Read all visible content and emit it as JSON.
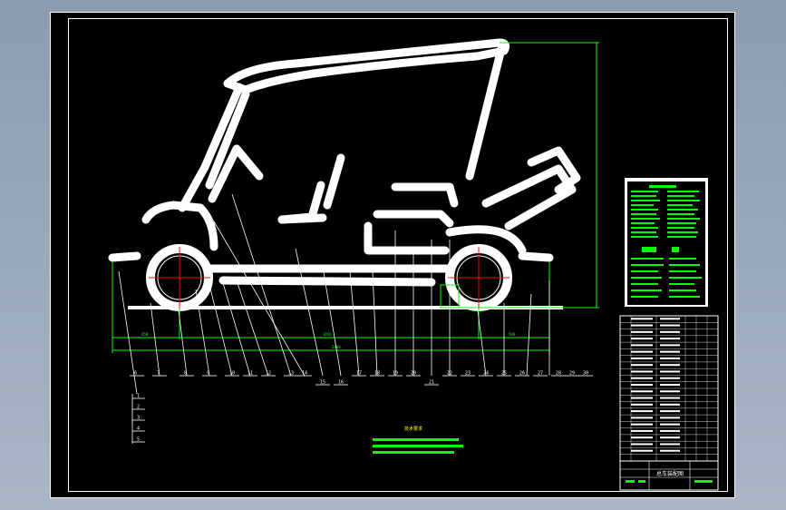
{
  "colors": {
    "background": "#000000",
    "outline": "#ffffff",
    "dimension": "#00ff00",
    "centerline": "#ff0000",
    "cyan": "#00ffff",
    "viewport": "#9aa8bc"
  },
  "drawing_title": "总车装配图",
  "notes_title": "技术要求",
  "balloons_bottom": [
    "6",
    "7",
    "8",
    "9",
    "10",
    "11",
    "12",
    "13",
    "14",
    "15",
    "16",
    "17",
    "18",
    "19",
    "20",
    "21",
    "22",
    "23",
    "24",
    "25",
    "26",
    "27",
    "28",
    "29",
    "30"
  ],
  "balloons_left": [
    "1",
    "2",
    "3",
    "4",
    "5"
  ],
  "dimensions": {
    "overall_length": "2680",
    "front_overhang": "450",
    "wheelbase": "1650",
    "rear_overhang": "580"
  },
  "parts_list_rows": 22
}
